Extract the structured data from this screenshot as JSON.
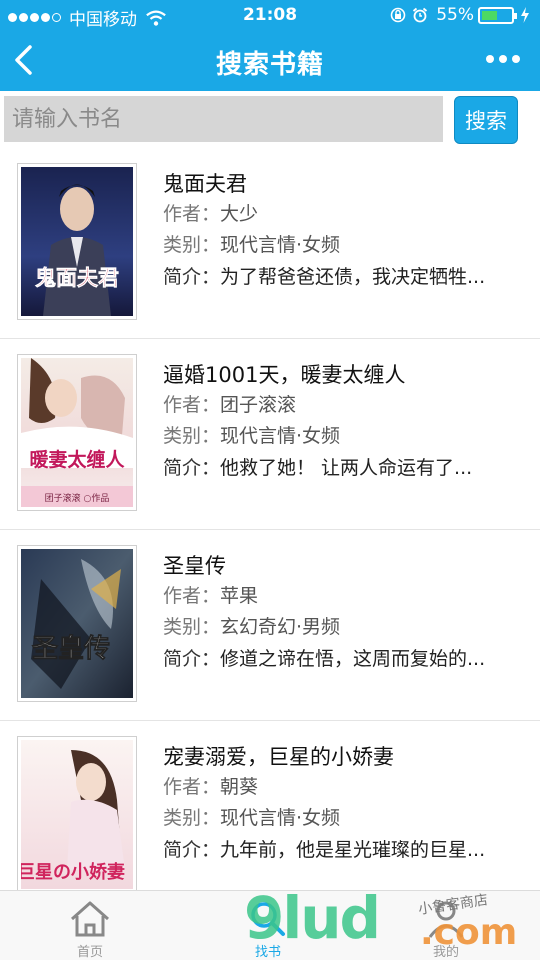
{
  "status_bar": {
    "carrier": "中国移动",
    "time": "21:08",
    "battery_pct": "55%",
    "battery_level": 0.55
  },
  "nav": {
    "title": "搜索书籍",
    "back_icon": "chevron-left-icon",
    "more_icon": "more-dots-icon"
  },
  "search": {
    "placeholder": "请输入书名",
    "value": "",
    "button_label": "搜索"
  },
  "books": [
    {
      "title": "鬼面夫君",
      "author_label": "作者：",
      "author": "大少",
      "category_label": "类别：",
      "category": "现代言情·女频",
      "intro_label": "简介：",
      "intro": "为了帮爸爸还债，我决定牺牲...",
      "cover_text": "鬼面夫君"
    },
    {
      "title": "逼婚1001天，暖妻太缠人",
      "author_label": "作者：",
      "author": "团子滚滚",
      "category_label": "类别：",
      "category": "现代言情·女频",
      "intro_label": "简介：",
      "intro": "他救了她！ 让两人命运有了...",
      "cover_text": "暖妻太缠人",
      "cover_author": "团子滚滚 ○作品"
    },
    {
      "title": "圣皇传",
      "author_label": "作者：",
      "author": "苹果",
      "category_label": "类别：",
      "category": "玄幻奇幻·男频",
      "intro_label": "简介：",
      "intro": "修道之谛在悟，这周而复始的...",
      "cover_text": "圣皇传"
    },
    {
      "title": "宠妻溺爱，巨星的小娇妻",
      "author_label": "作者：",
      "author": "朝葵",
      "category_label": "类别：",
      "category": "现代言情·女频",
      "intro_label": "简介：",
      "intro": "九年前，他是星光璀璨的巨星...",
      "cover_text": "巨星の小娇妻"
    }
  ],
  "tabbar": {
    "home_label": "首页",
    "search_label": "找书",
    "mine_label": "我的"
  },
  "watermark": {
    "main": "9lud",
    "com": ".com",
    "shop": "小鲁客商店"
  },
  "colors": {
    "primary": "#1aa8e6",
    "search_field_bg": "#d6d6d6"
  }
}
